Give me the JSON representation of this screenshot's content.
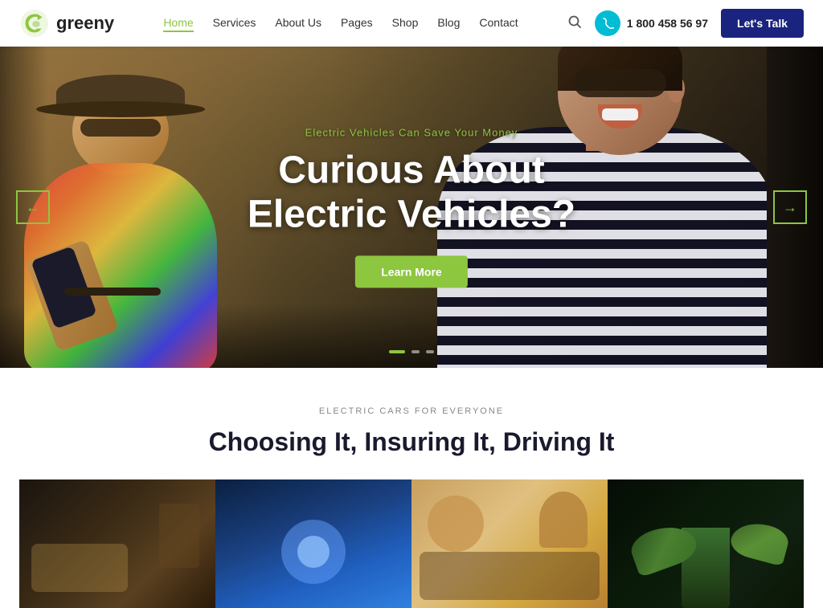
{
  "logo": {
    "text": "greeny",
    "icon_label": "greeny-logo-icon"
  },
  "navbar": {
    "links": [
      {
        "label": "Home",
        "active": true
      },
      {
        "label": "Services",
        "active": false
      },
      {
        "label": "About Us",
        "active": false
      },
      {
        "label": "Pages",
        "active": false
      },
      {
        "label": "Shop",
        "active": false
      },
      {
        "label": "Blog",
        "active": false
      },
      {
        "label": "Contact",
        "active": false
      }
    ],
    "phone": "1 800 458 56 97",
    "cta_label": "Let's Talk"
  },
  "hero": {
    "subtitle": "Electric Vehicles Can Save Your Money",
    "title_line1": "Curious About",
    "title_line2": "Electric Vehicles?",
    "btn_label": "Learn More",
    "arrow_left": "←",
    "arrow_right": "→",
    "dots": [
      {
        "active": true
      },
      {
        "active": false
      },
      {
        "active": false
      }
    ]
  },
  "section": {
    "label": "ELECTRIC CARS FOR EVERYONE",
    "title": "Choosing It, Insuring It, Driving It",
    "cards": [
      {
        "alt": "car-interior-card"
      },
      {
        "alt": "charging-port-card"
      },
      {
        "alt": "people-in-car-card"
      },
      {
        "alt": "green-plant-card"
      }
    ]
  },
  "colors": {
    "accent_green": "#8dc63f",
    "accent_dark_blue": "#1a237e",
    "nav_active": "#8dc63f"
  }
}
